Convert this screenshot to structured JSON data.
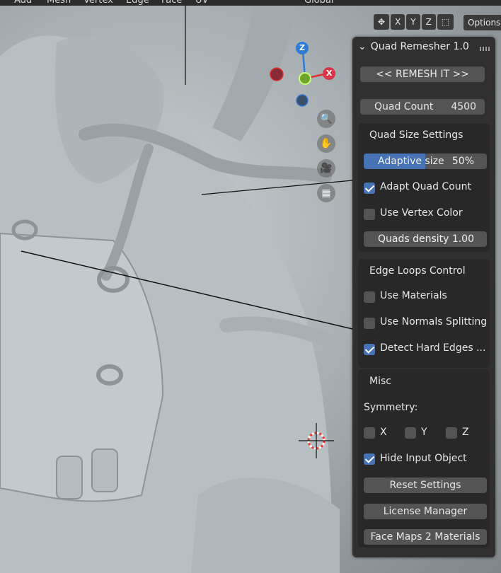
{
  "header_menu": [
    "Add",
    "Mesh",
    "Vertex",
    "Edge",
    "Face",
    "UV"
  ],
  "header_orientation": "Global",
  "axis_toggles": [
    "X",
    "Y",
    "Z"
  ],
  "options_label": "Options",
  "gizmo": {
    "z": "Z",
    "x": "X"
  },
  "panel": {
    "title": "Quad Remesher 1.0",
    "remesh_button": "<<  REMESH IT  >>",
    "quad_count_label": "Quad Count",
    "quad_count_value": "4500",
    "quad_size": {
      "heading": "Quad Size Settings",
      "adaptive_label": "Adaptive size",
      "adaptive_value": "50%",
      "adaptive_fraction": 0.5,
      "adapt_quad_count": "Adapt Quad Count",
      "use_vertex_color": "Use Vertex Color",
      "quads_density_label": "Quads density",
      "quads_density_value": "1.00"
    },
    "edge_loops": {
      "heading": "Edge Loops Control",
      "use_materials": "Use Materials",
      "use_normals_splitting": "Use Normals Splitting",
      "detect_hard_edges": "Detect Hard Edges ..."
    },
    "misc": {
      "heading": "Misc",
      "symmetry_label": "Symmetry:",
      "sym_x": "X",
      "sym_y": "Y",
      "sym_z": "Z",
      "hide_input_object": "Hide Input Object",
      "reset_settings": "Reset Settings",
      "license_manager": "License Manager",
      "face_maps": "Face Maps 2 Materials"
    }
  },
  "colors": {
    "accent": "#4772b3",
    "panel_bg": "#303030",
    "box_bg": "#282828",
    "button": "#545454"
  }
}
